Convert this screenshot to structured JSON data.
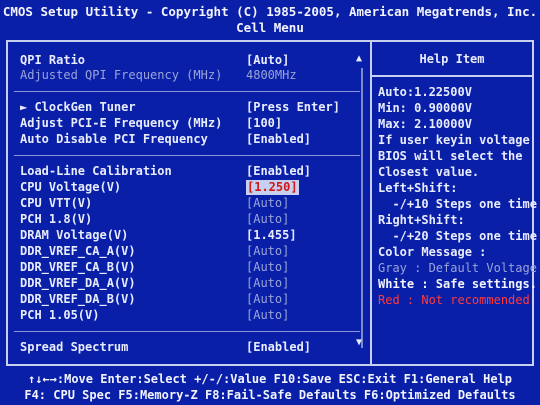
{
  "header": {
    "title": "CMOS Setup Utility - Copyright (C) 1985-2005, American Megatrends, Inc.",
    "subtitle": "Cell Menu"
  },
  "settings": [
    {
      "label": "QPI Ratio",
      "value": "[Auto]",
      "dim": false
    },
    {
      "label": "Adjusted QPI Frequency (MHz)",
      "value": "4800MHz",
      "dim": true
    },
    {
      "label": "► ClockGen Tuner",
      "value": "[Press Enter]",
      "dim": false
    },
    {
      "label": "Adjust PCI-E Frequency (MHz)",
      "value": "[100]",
      "dim": false
    },
    {
      "label": "Auto Disable PCI Frequency",
      "value": "[Enabled]",
      "dim": false
    },
    {
      "label": "Load-Line Calibration",
      "value": "[Enabled]",
      "dim": false
    },
    {
      "label": "CPU Voltage(V)",
      "value": "[1.250]",
      "dim": false,
      "selected": true
    },
    {
      "label": "CPU VTT(V)",
      "value": "[Auto]",
      "dim": false,
      "valdim": true
    },
    {
      "label": "PCH 1.8(V)",
      "value": "[Auto]",
      "dim": false,
      "valdim": true
    },
    {
      "label": "DRAM Voltage(V)",
      "value": "[1.455]",
      "dim": false
    },
    {
      "label": "DDR_VREF_CA_A(V)",
      "value": "[Auto]",
      "dim": false,
      "valdim": true
    },
    {
      "label": "DDR_VREF_CA_B(V)",
      "value": "[Auto]",
      "dim": false,
      "valdim": true
    },
    {
      "label": "DDR_VREF_DA_A(V)",
      "value": "[Auto]",
      "dim": false,
      "valdim": true
    },
    {
      "label": "DDR_VREF_DA_B(V)",
      "value": "[Auto]",
      "dim": false,
      "valdim": true
    },
    {
      "label": "PCH 1.05(V)",
      "value": "[Auto]",
      "dim": false,
      "valdim": true
    },
    {
      "label": "Spread Spectrum",
      "value": "[Enabled]",
      "dim": false
    }
  ],
  "help": {
    "title": "Help Item",
    "lines": [
      "Auto:1.22500V",
      "Min: 0.90000V",
      "Max: 2.10000V",
      "If user keyin voltage",
      "BIOS will select the",
      "Closest value.",
      "Left+Shift:",
      "  -/+10 Steps one time",
      "Right+Shift:",
      "  -/+20 Steps one time",
      "Color Message :",
      "Gray : Default Voltage",
      "White : Safe settings.",
      "Red : Not recommended"
    ]
  },
  "footer": {
    "line1": "↑↓←→:Move  Enter:Select  +/-/:Value  F10:Save  ESC:Exit  F1:General Help",
    "line2": "F4: CPU Spec  F5:Memory-Z  F8:Fail-Safe Defaults  F6:Optimized Defaults"
  },
  "colors": {
    "background": "#0a1fa8",
    "text": "#e8ecff",
    "dim_text": "#9aa4d8",
    "highlight_bg": "#c8d0f0",
    "highlight_text": "#d01818",
    "warning": "#ff3a3a"
  },
  "icons": {
    "scroll_up": "▲",
    "scroll_down": "▼"
  }
}
